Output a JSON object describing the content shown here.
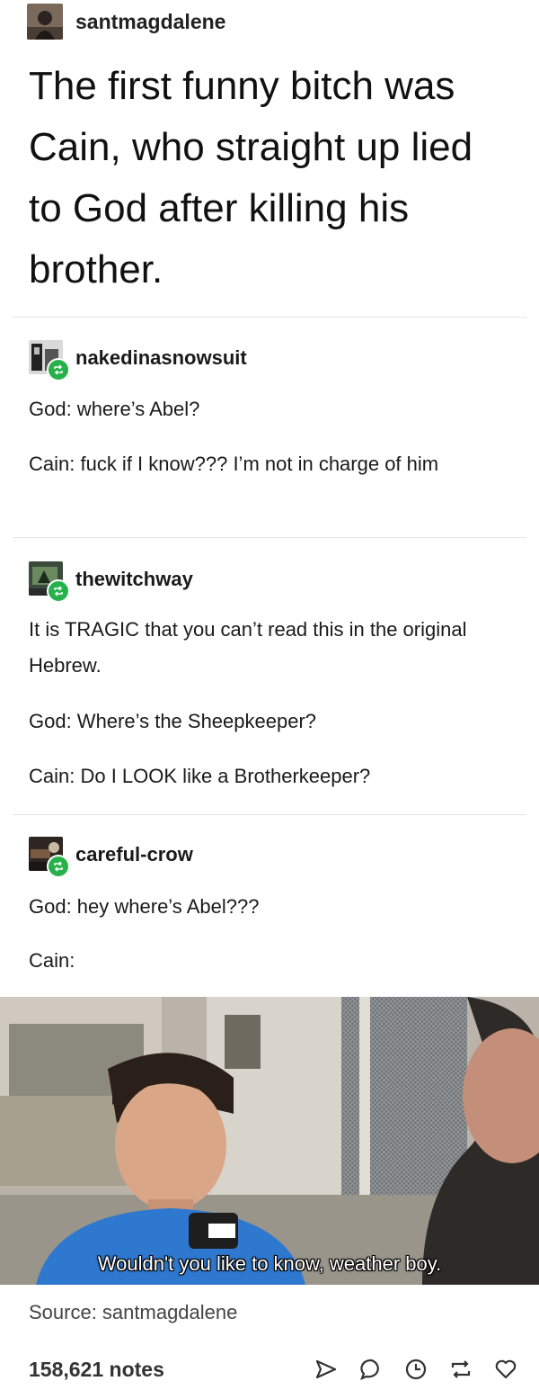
{
  "post": {
    "author": "santmagdalene",
    "text": "The first funny bitch was Cain, who straight up lied to God after killing his brother."
  },
  "reblogs": [
    {
      "user": "nakedinasnowsuit",
      "lines": [
        "God: where’s Abel?",
        "Cain: fuck if I know??? I’m not in charge of him"
      ]
    },
    {
      "user": "thewitchway",
      "lines": [
        "It is TRAGIC that you can’t read this in the original Hebrew.",
        "God:  Where’s the Sheepkeeper?",
        "Cain: Do I LOOK like a Brotherkeeper?"
      ]
    },
    {
      "user": "careful-crow",
      "lines": [
        "God: hey where’s Abel???",
        "Cain:"
      ]
    }
  ],
  "meme": {
    "caption": "Wouldn't you like to know, weather boy.",
    "logo": "FOX 5"
  },
  "footer": {
    "source": "Source: santmagdalene",
    "notes": "158,621 notes",
    "actions": [
      "share-icon",
      "reply-icon",
      "history-icon",
      "reblog-icon",
      "like-icon"
    ]
  },
  "colors": {
    "reblog_badge": "#27b14a",
    "text": "#1a1a1a",
    "divider": "#e6e6e6"
  }
}
